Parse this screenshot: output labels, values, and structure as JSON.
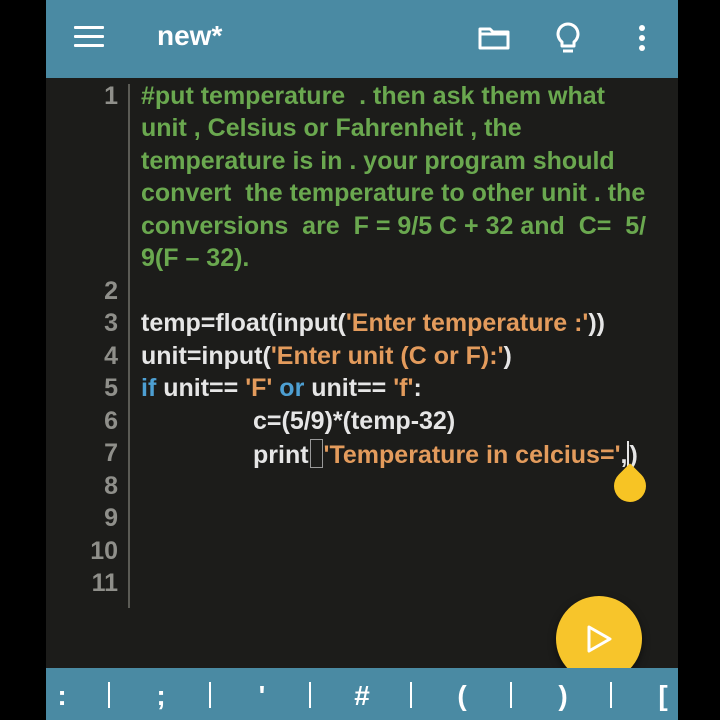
{
  "topbar": {
    "title": "new*",
    "icons": [
      "menu-icon",
      "folder-icon",
      "lightbulb-icon",
      "more-vert-icon"
    ]
  },
  "editor": {
    "line_numbers": [
      "1",
      "2",
      "3",
      "4",
      "5",
      "6",
      "7",
      "8",
      "9",
      "10",
      "11"
    ],
    "lines": {
      "l1": [
        "#put temperature  . then ask them what",
        "unit , Celsius or Fahrenheit , the",
        "temperature is in . your program should",
        "convert  the temperature to other unit . the",
        "conversions  are  F = 9/5 C + 32 and  C=  5/",
        "9(F – 32)."
      ],
      "l3": {
        "a": "temp=float(input(",
        "s": "'Enter temperature :'",
        "b": "))"
      },
      "l4": {
        "a": "unit=input(",
        "s": "'Enter unit (C or F):'",
        "b": ")"
      },
      "l5": {
        "k1": "if",
        "a": " unit== ",
        "s1": "'F'",
        "k2": " or ",
        "b": "unit== ",
        "s2": "'f'",
        "c": ":"
      },
      "l6": "c=(5/9)*(temp-32)",
      "l7": {
        "a": "print",
        "p": "(",
        "s": "'Temperature in celcius='",
        "b": ",",
        "c": ")"
      }
    }
  },
  "fab": {
    "icon": "play-icon"
  },
  "symbols": [
    ":",
    ";",
    "'",
    "#",
    "(",
    ")",
    "["
  ],
  "colors": {
    "bar": "#4a8aa3",
    "background": "#1c1c1a",
    "comment": "#6aa84f",
    "string": "#e39b5c",
    "keyword": "#4d9fd2",
    "accent": "#f7c52b"
  }
}
